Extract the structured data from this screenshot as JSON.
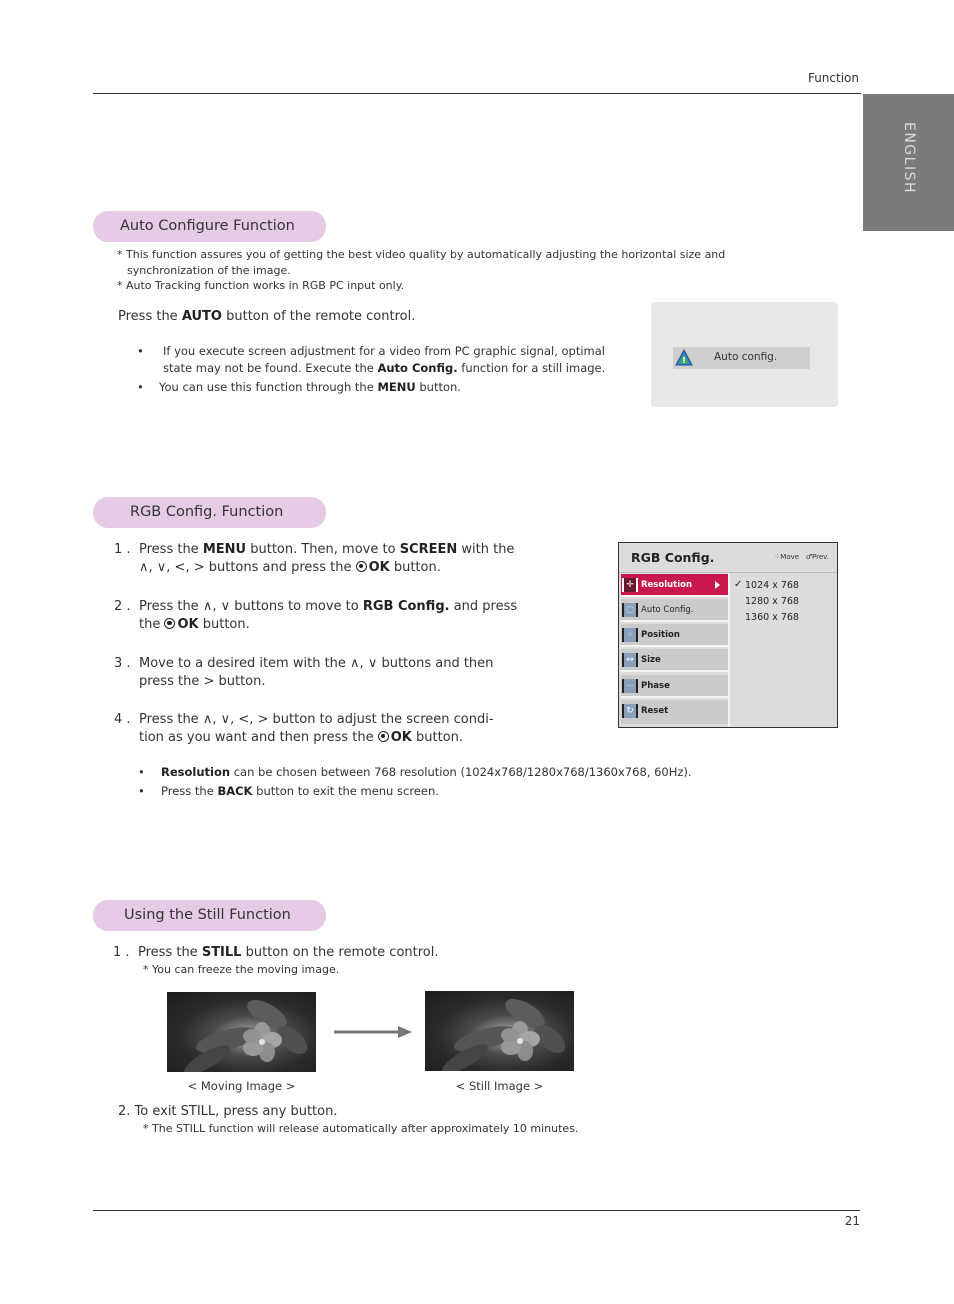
{
  "header": {
    "section_label": "Function",
    "language_tab": "ENGLISH"
  },
  "auto_configure": {
    "title": "Auto Configure Function",
    "notes": [
      "* This function assures you of getting the best video quality by automatically adjusting the horizontal size and",
      "synchronization of the image.",
      "* Auto Tracking function works in RGB PC input only."
    ],
    "instruction": {
      "prefix": "Press the ",
      "key": "AUTO",
      "suffix": " button of the remote control."
    },
    "bullets": [
      {
        "line1": "If you execute screen adjustment for a video from PC graphic signal, optimal",
        "line2_prefix": "state may not be found. Execute the ",
        "line2_bold": "Auto Config.",
        "line2_suffix": " function for a still image."
      },
      {
        "prefix": "You can use this function through the ",
        "bold": "MENU",
        "suffix": " button."
      }
    ],
    "osd": {
      "label": "Auto config.",
      "icon": "warning-icon"
    }
  },
  "rgb_config": {
    "title": "RGB Config. Function",
    "steps": [
      {
        "num": "1 .",
        "a": "Press the ",
        "b1": "MENU",
        "c": " button. Then, move to ",
        "b2": "SCREEN",
        "d": " with the",
        "line2": "∧, ∨, <, > buttons and press the ",
        "ok": "OK",
        "end": " button."
      },
      {
        "num": "2 .",
        "a": "Press the ∧, ∨ buttons to move to ",
        "b1": "RGB Config.",
        "c": " and press",
        "line2": "the ",
        "ok": "OK",
        "end": " button."
      },
      {
        "num": "3 .",
        "a": "Move to a desired item with the ∧, ∨ buttons and then",
        "line2": "press the >  button."
      },
      {
        "num": "4 .",
        "a": "Press the ∧, ∨, <, >  button to adjust the screen condi-",
        "line2": "tion as you want and then press the ",
        "ok": "OK",
        "end": " button."
      }
    ],
    "bullets": [
      {
        "bold": "Resolution",
        "text": " can be chosen between 768 resolution (1024x768/1280x768/1360x768, 60Hz)."
      },
      {
        "prefix": "Press the ",
        "bold": "BACK",
        "text": " button to exit the menu screen."
      }
    ],
    "menu": {
      "title": "RGB Config.",
      "nav_move": "Move",
      "nav_prev": "Prev.",
      "items": [
        {
          "label": "Resolution",
          "icon": "move-icon",
          "glyph": "✛",
          "selected": true
        },
        {
          "label": "Auto Config.",
          "icon": "auto-config-icon",
          "glyph": "◌"
        },
        {
          "label": "Position",
          "icon": "position-icon",
          "glyph": "⁘"
        },
        {
          "label": "Size",
          "icon": "size-icon",
          "glyph": "↔"
        },
        {
          "label": "Phase",
          "icon": "phase-icon",
          "glyph": "···"
        },
        {
          "label": "Reset",
          "icon": "reset-icon",
          "glyph": "↻"
        }
      ],
      "resolutions": [
        {
          "label": "1024 x 768",
          "checked": true
        },
        {
          "label": "1280 x 768",
          "checked": false
        },
        {
          "label": "1360 x 768",
          "checked": false
        }
      ]
    }
  },
  "still": {
    "title": "Using the Still Function",
    "step1": {
      "num": "1 .",
      "prefix": "Press the ",
      "bold": "STILL",
      "suffix": " button on the remote control.",
      "note": "* You can freeze the moving image."
    },
    "captions": {
      "moving": "< Moving Image >",
      "still": "< Still Image >"
    },
    "step2": {
      "text": "2. To exit STILL, press any button.",
      "note": "* The STILL function will release automatically after approximately 10 minutes."
    }
  },
  "footer": {
    "page_number": "21"
  },
  "colors": {
    "pill": "#e6cbe6",
    "menu_selected": "#c8194f",
    "lang_tab": "#7c7b7b"
  }
}
